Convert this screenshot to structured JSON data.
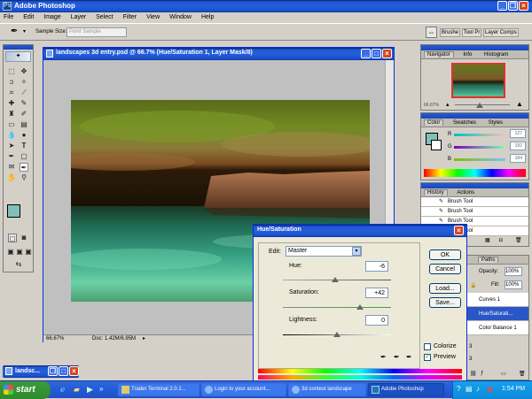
{
  "app": {
    "title": "Adobe Photoshop"
  },
  "menu": [
    "File",
    "Edit",
    "Image",
    "Layer",
    "Select",
    "Filter",
    "View",
    "Window",
    "Help"
  ],
  "options": {
    "sample_size_label": "Sample Size:",
    "sample_size_value": "Point Sample"
  },
  "palette_well": {
    "tabs": [
      "Brushe",
      "Tool Pr",
      "Layer Comps"
    ]
  },
  "document": {
    "title": "landscapes 3d entry.psd @ 66.7% (Hue/Saturation 1, Layer Mask/8)",
    "zoom": "66.67%",
    "doc_size": "Doc: 1.42M/6.95M"
  },
  "minimized_doc": {
    "title": "landsc..."
  },
  "navigator": {
    "tabs": [
      "Navigator",
      "Info",
      "Histogram"
    ],
    "zoom": "66.67%"
  },
  "color_panel": {
    "tabs": [
      "Color",
      "Swatches",
      "Styles"
    ],
    "channels": [
      {
        "label": "R",
        "value": "127"
      },
      {
        "label": "G",
        "value": "192"
      },
      {
        "label": "B",
        "value": "184"
      }
    ]
  },
  "history": {
    "tabs": [
      "History",
      "Actions"
    ],
    "items": [
      "Brush Tool",
      "Brush Tool",
      "Brush Tool",
      "Brush Tool"
    ]
  },
  "layers": {
    "tab": "Paths",
    "opacity_label": "Opacity:",
    "opacity": "100%",
    "fill_label": "Fill:",
    "fill": "100%",
    "items": [
      "Curves 1",
      "Hue/Saturati...",
      "Color Balance 1"
    ],
    "extra": [
      "3",
      "3"
    ]
  },
  "hue_sat": {
    "title": "Hue/Saturation",
    "edit_label": "Edit:",
    "edit_value": "Master",
    "hue_label": "Hue:",
    "hue": "-6",
    "saturation_label": "Saturation:",
    "saturation": "+42",
    "lightness_label": "Lightness:",
    "lightness": "0",
    "ok": "OK",
    "cancel": "Cancel",
    "load": "Load...",
    "save": "Save...",
    "colorize": "Colorize",
    "preview": "Preview",
    "colorize_checked": false,
    "preview_checked": true,
    "hue_level": -6,
    "saturation_level": 42,
    "lightness_level": 0
  },
  "taskbar": {
    "start": "start",
    "items": [
      "Trader Terminal 2.0.1...",
      "Login to your account...",
      "3d contest landscape",
      "Adobe Photoshop"
    ],
    "clock": "1:54 PM"
  }
}
